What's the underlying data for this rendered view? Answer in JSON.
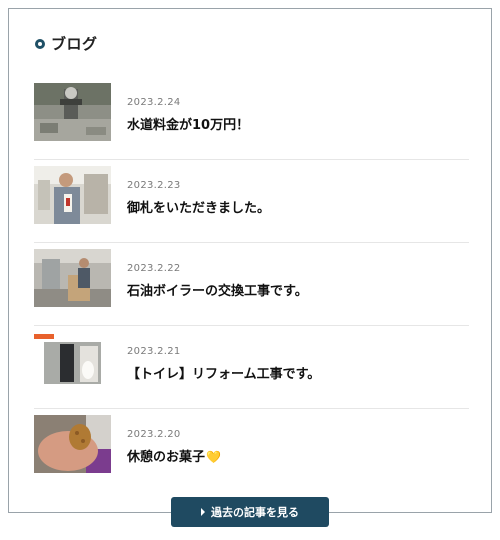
{
  "section": {
    "title": "ブログ",
    "icon": "ring-bullet-icon"
  },
  "posts": [
    {
      "date": "2023.2.24",
      "title": "水道料金が10万円！",
      "thumb": "outdoor-faucet-photo"
    },
    {
      "date": "2023.2.23",
      "title": "御札をいただきました。",
      "thumb": "man-with-amulet-photo"
    },
    {
      "date": "2023.2.22",
      "title": "石油ボイラーの交換工事です。",
      "thumb": "boiler-installation-photo"
    },
    {
      "date": "2023.2.21",
      "title": "【トイレ】リフォーム工事です。",
      "thumb": "toilet-reform-photo"
    },
    {
      "date": "2023.2.20",
      "title": "休憩のお菓子",
      "emoji": "💛",
      "thumb": "snack-in-hand-photo"
    }
  ],
  "more_button": {
    "label": "過去の記事を見る"
  },
  "colors": {
    "accent": "#1f4a61",
    "date": "#7a7a7a",
    "border": "#9aa3aa"
  }
}
